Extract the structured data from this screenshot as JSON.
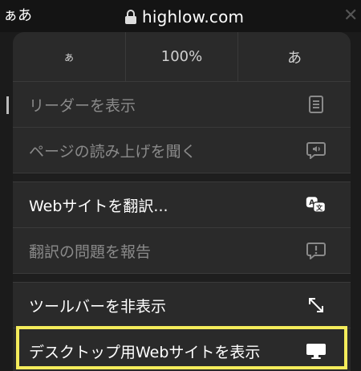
{
  "address_bar": {
    "aa_label": "ぁあ",
    "url": "highlow.com",
    "close_glyph": "✕"
  },
  "zoom": {
    "decrease_label": "ぁ",
    "level": "100%",
    "increase_label": "あ"
  },
  "menu_items": [
    {
      "label": "リーダーを表示",
      "icon": "reader-icon",
      "enabled": false
    },
    {
      "label": "ページの読み上げを聞く",
      "icon": "speaker-icon",
      "enabled": false
    },
    {
      "label": "Webサイトを翻訳...",
      "icon": "translate-icon",
      "enabled": true
    },
    {
      "label": "翻訳の問題を報告",
      "icon": "report-icon",
      "enabled": false
    },
    {
      "label": "ツールバーを非表示",
      "icon": "expand-arrows-icon",
      "enabled": true
    },
    {
      "label": "デスクトップ用Webサイトを表示",
      "icon": "desktop-icon",
      "enabled": true
    }
  ],
  "colors": {
    "highlight": "#f4ec5b",
    "menu_bg": "#2a2a2a",
    "disabled_text": "#8a8a8a"
  }
}
